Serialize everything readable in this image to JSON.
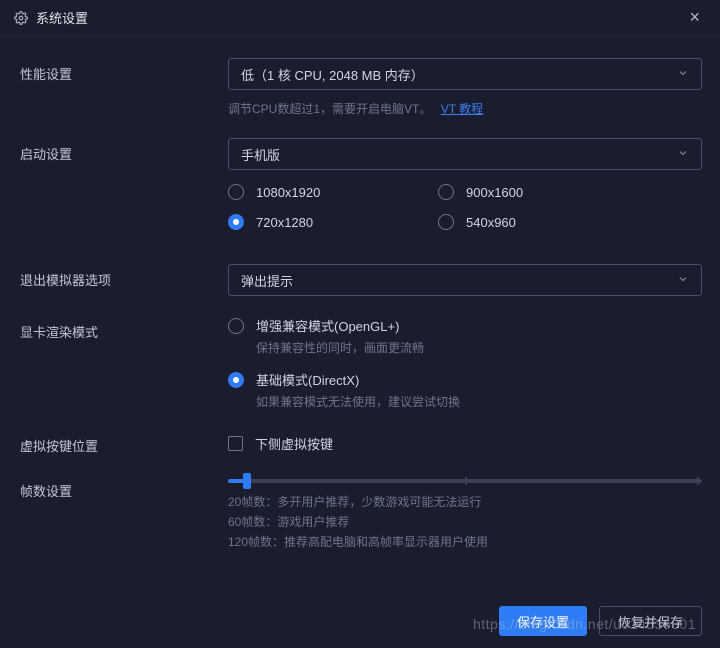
{
  "window": {
    "title": "系统设置",
    "close_icon": "×"
  },
  "performance": {
    "label": "性能设置",
    "select_value": "低（1 核 CPU, 2048 MB 内存）",
    "hint_text": "调节CPU数超过1，需要开启电脑VT。",
    "hint_link": "VT 教程"
  },
  "boot": {
    "label": "启动设置",
    "select_value": "手机版",
    "resolutions": [
      {
        "label": "1080x1920",
        "selected": false
      },
      {
        "label": "900x1600",
        "selected": false
      },
      {
        "label": "720x1280",
        "selected": true
      },
      {
        "label": "540x960",
        "selected": false
      }
    ]
  },
  "exit": {
    "label": "退出模拟器选项",
    "select_value": "弹出提示"
  },
  "render": {
    "label": "显卡渲染模式",
    "option1_label": "增强兼容模式(OpenGL+)",
    "option1_hint": "保持兼容性的同时，画面更流畅",
    "option1_selected": false,
    "option2_label": "基础模式(DirectX)",
    "option2_hint": "如果兼容模式无法使用，建议尝试切换",
    "option2_selected": true
  },
  "virtual_keys": {
    "label": "虚拟按键位置",
    "checkbox_label": "下侧虚拟按键",
    "checked": false
  },
  "fps": {
    "label": "帧数设置",
    "hint1": "20帧数：多开用户推荐，少数游戏可能无法运行",
    "hint2": "60帧数：游戏用户推荐",
    "hint3": "120帧数：推荐高配电脑和高帧率显示器用户使用"
  },
  "footer": {
    "save": "保存设置",
    "restore": "恢复并保存"
  },
  "watermark": "https://blog.csdn.net/u014536801"
}
